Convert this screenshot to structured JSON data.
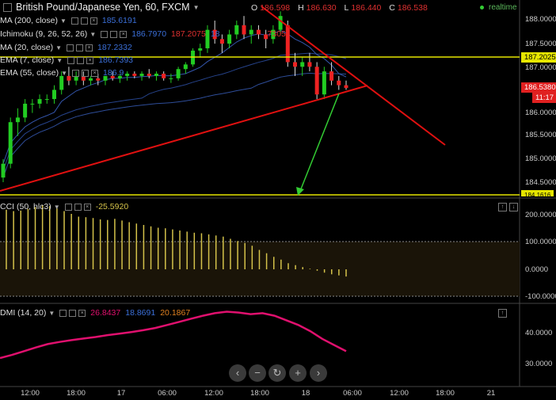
{
  "title": "British Pound/Japanese Yen, 60, FXCM",
  "ohlc": {
    "o_label": "O",
    "o": "186.598",
    "h_label": "H",
    "h": "186.630",
    "l_label": "L",
    "l": "186.440",
    "c_label": "C",
    "c": "186.538"
  },
  "realtime": "realtime",
  "indicators": [
    {
      "name": "MA (200, close)",
      "value": "185.6191",
      "color": "#3b6fd8"
    },
    {
      "name": "Ichimoku (9, 26, 52, 26)",
      "value": "186.7970",
      "color": "#3b6fd8",
      "extra": [
        "187.2075",
        "18",
        "7305"
      ]
    },
    {
      "name": "MA (20, close)",
      "value": "187.2332",
      "color": "#3b6fd8"
    },
    {
      "name": "EMA (7, close)",
      "value": "186.7393",
      "color": "#3b6fd8"
    },
    {
      "name": "EMA (55, close)",
      "value": "186.9",
      "color": "#3b6fd8"
    }
  ],
  "price_axis": [
    "188.0000",
    "187.5000",
    "187.0000",
    "186.5000",
    "186.0000",
    "185.5000",
    "185.0000",
    "184.5000"
  ],
  "price_badges": {
    "level": "187.2025",
    "current": "186.5380",
    "countdown": "11:17",
    "bottom": "184.1616"
  },
  "cci": {
    "name": "CCI (50, hlc3)",
    "value": "-25.5920",
    "axis": [
      "200.0000",
      "100.0000",
      "0.0000",
      "-100.0000"
    ]
  },
  "dmi": {
    "name": "DMI (14, 20)",
    "v1": "26.8437",
    "v2": "18.8691",
    "v3": "20.1867",
    "axis": [
      "40.0000",
      "30.0000"
    ]
  },
  "time_axis": [
    "12:00",
    "18:00",
    "17",
    "06:00",
    "12:00",
    "18:00",
    "18",
    "06:00",
    "12:00",
    "18:00",
    "21"
  ],
  "zoom_controls": [
    "‹",
    "−",
    "↻",
    "+",
    "›"
  ],
  "colors": {
    "up": "#22cc22",
    "down": "#ee2222",
    "cci": "#d4c24a",
    "dmi": "#e0106e",
    "level": "#e6e600",
    "trend": "#e01010",
    "arrow": "#33cc33",
    "ma": "#3a5fc0"
  },
  "chart_data": {
    "type": "candlestick",
    "ylim": [
      184.3,
      188.2
    ],
    "candles": [
      [
        184.6,
        185.0,
        184.5,
        184.9
      ],
      [
        184.9,
        185.9,
        184.8,
        185.8
      ],
      [
        185.8,
        186.1,
        185.5,
        185.9
      ],
      [
        185.9,
        186.3,
        185.8,
        186.2
      ],
      [
        186.2,
        186.3,
        186.0,
        186.2
      ],
      [
        186.2,
        186.4,
        186.1,
        186.3
      ],
      [
        186.3,
        186.4,
        186.2,
        186.3
      ],
      [
        186.3,
        186.6,
        186.2,
        186.5
      ],
      [
        186.5,
        186.9,
        186.4,
        186.8
      ],
      [
        186.8,
        187.0,
        186.6,
        186.7
      ],
      [
        186.7,
        186.9,
        186.6,
        186.8
      ],
      [
        186.8,
        186.9,
        186.6,
        186.7
      ],
      [
        186.7,
        186.8,
        186.6,
        186.75
      ],
      [
        186.75,
        186.85,
        186.6,
        186.7
      ],
      [
        186.7,
        186.8,
        186.6,
        186.8
      ],
      [
        186.8,
        186.9,
        186.7,
        186.75
      ],
      [
        186.75,
        186.85,
        186.65,
        186.8
      ],
      [
        186.8,
        186.9,
        186.7,
        186.85
      ],
      [
        186.85,
        186.9,
        186.75,
        186.8
      ],
      [
        186.8,
        186.9,
        186.7,
        186.85
      ],
      [
        186.85,
        186.95,
        186.75,
        186.8
      ],
      [
        186.8,
        186.9,
        186.7,
        186.85
      ],
      [
        186.85,
        186.9,
        186.7,
        186.75
      ],
      [
        186.75,
        186.85,
        186.65,
        186.75
      ],
      [
        186.75,
        187.0,
        186.7,
        186.95
      ],
      [
        186.95,
        187.1,
        186.85,
        187.05
      ],
      [
        187.05,
        187.4,
        187.0,
        187.35
      ],
      [
        187.35,
        187.5,
        187.2,
        187.4
      ],
      [
        187.4,
        187.9,
        187.3,
        187.8
      ],
      [
        187.8,
        188.0,
        187.5,
        187.6
      ],
      [
        187.6,
        187.7,
        187.3,
        187.5
      ],
      [
        187.5,
        187.8,
        187.4,
        187.7
      ],
      [
        187.7,
        188.0,
        187.6,
        187.9
      ],
      [
        187.9,
        188.1,
        187.6,
        187.7
      ],
      [
        187.7,
        187.9,
        187.5,
        187.8
      ],
      [
        187.8,
        187.9,
        187.6,
        187.7
      ],
      [
        187.7,
        187.8,
        187.4,
        187.6
      ],
      [
        187.6,
        187.9,
        187.5,
        187.8
      ],
      [
        187.8,
        188.2,
        187.7,
        188.1
      ],
      [
        187.9,
        188.0,
        187.0,
        187.1
      ],
      [
        187.1,
        187.3,
        186.8,
        187.0
      ],
      [
        187.0,
        187.2,
        186.8,
        187.1
      ],
      [
        187.1,
        187.3,
        186.9,
        187.0
      ],
      [
        187.0,
        187.1,
        186.3,
        186.4
      ],
      [
        186.4,
        187.0,
        186.3,
        186.9
      ],
      [
        186.9,
        187.1,
        186.6,
        186.7
      ],
      [
        186.7,
        186.8,
        186.5,
        186.6
      ],
      [
        186.6,
        186.7,
        186.5,
        186.54
      ]
    ],
    "cci_values": [
      215,
      210,
      212,
      218,
      225,
      232,
      228,
      220,
      210,
      200,
      190,
      188,
      185,
      180,
      178,
      182,
      176,
      170,
      165,
      160,
      155,
      150,
      148,
      144,
      140,
      136,
      132,
      130,
      126,
      122,
      118,
      110,
      102,
      95,
      85,
      70,
      58,
      45,
      35,
      22,
      15,
      8,
      2,
      -5,
      -12,
      -18,
      -22,
      -26
    ],
    "dmi_values": [
      31.8,
      32.8,
      34.0,
      35.2,
      36.3,
      37.0,
      37.6,
      38.1,
      38.6,
      39.2,
      39.7,
      40.2,
      40.8,
      41.5,
      42.5,
      43.5,
      44.5,
      45.5,
      46.3,
      46.8,
      46.5,
      46.0,
      46.3,
      45.5,
      44.0,
      42.5,
      40.5,
      38.0,
      36.0,
      34.0
    ]
  }
}
